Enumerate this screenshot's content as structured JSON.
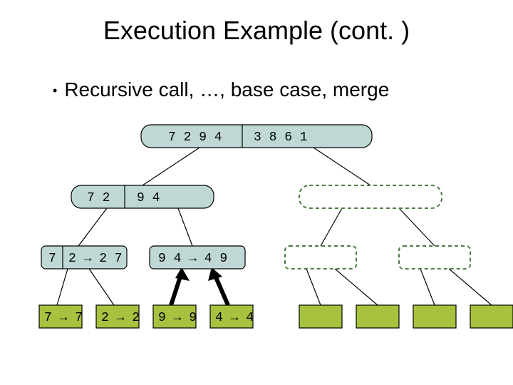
{
  "title": "Execution Example (cont. )",
  "bullet": "Recursive call, …, base case, merge",
  "nodes": {
    "L0": {
      "left": "7 2 9 4",
      "right": "3 8 6 1"
    },
    "L1_left": {
      "left": "7 2",
      "right": "9 4"
    },
    "L2_a": {
      "left": "7",
      "right": "2 → 2 7"
    },
    "L2_b": "9 4 → 4 9",
    "L3_a": "7 → 7",
    "L3_b": "2 → 2",
    "L3_c": "9 → 9",
    "L3_d": "4 → 4"
  }
}
